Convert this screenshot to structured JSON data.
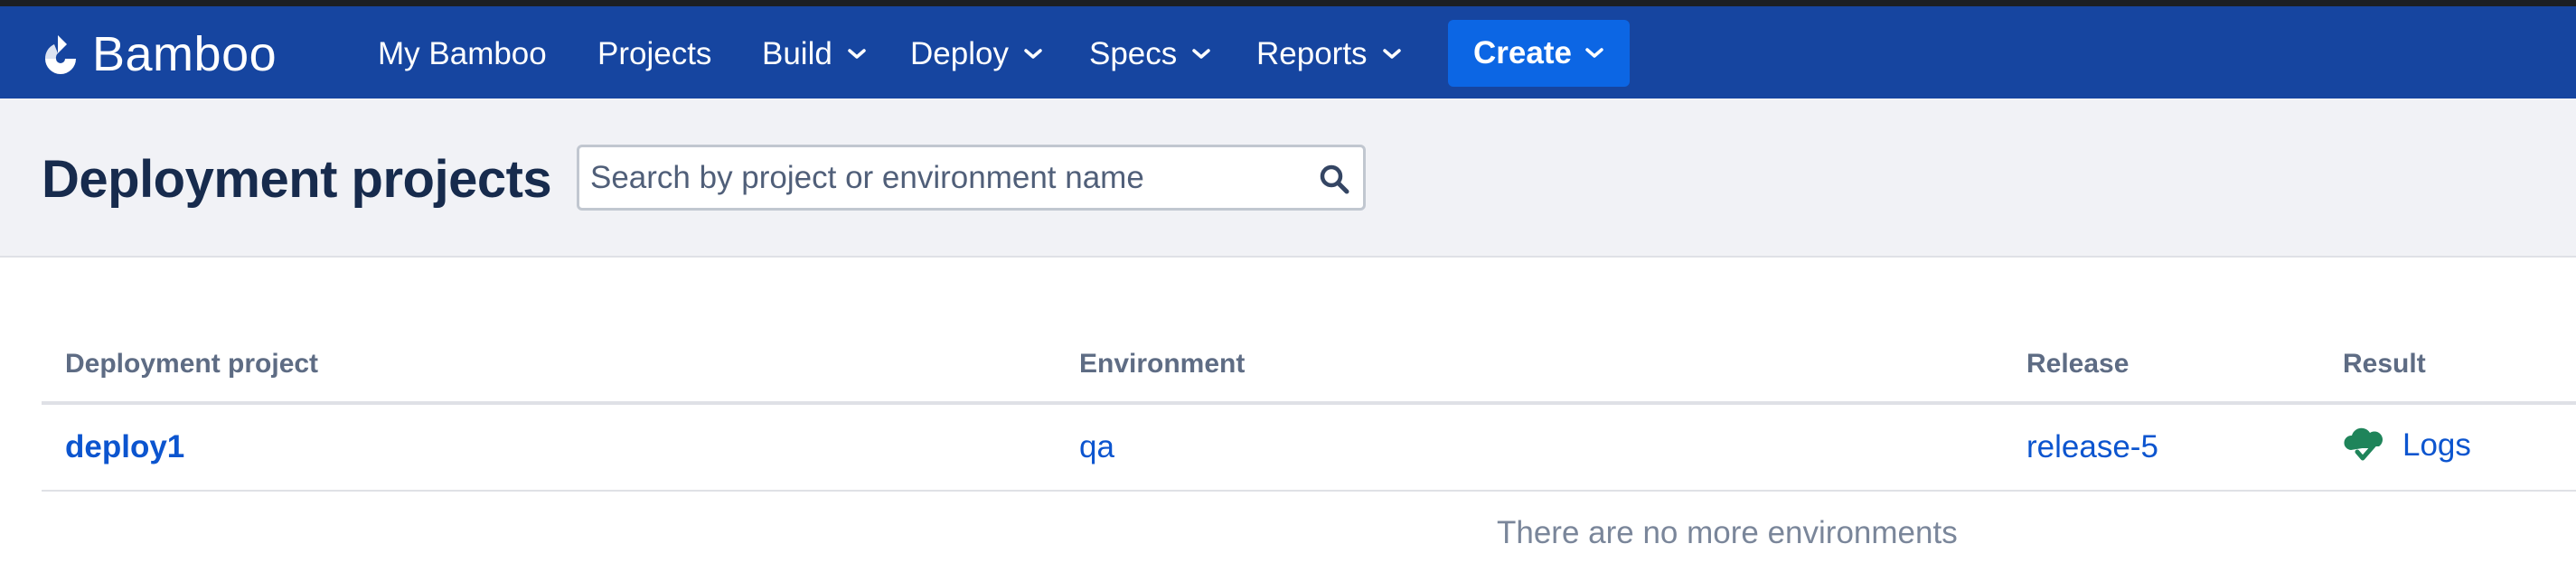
{
  "app": {
    "name": "Bamboo"
  },
  "nav": {
    "items": [
      {
        "label": "My Bamboo",
        "has_dropdown": false
      },
      {
        "label": "Projects",
        "has_dropdown": false
      },
      {
        "label": "Build",
        "has_dropdown": true
      },
      {
        "label": "Deploy",
        "has_dropdown": true
      },
      {
        "label": "Specs",
        "has_dropdown": true
      },
      {
        "label": "Reports",
        "has_dropdown": true
      }
    ],
    "create_label": "Create"
  },
  "page": {
    "title": "Deployment projects"
  },
  "search": {
    "placeholder": "Search by project or environment name",
    "value": ""
  },
  "table": {
    "columns": [
      "Deployment project",
      "Environment",
      "Release",
      "Result"
    ],
    "rows": [
      {
        "project": "deploy1",
        "environment": "qa",
        "release": "release-5",
        "result_link": "Logs",
        "result_icon": "deploy-success-icon"
      }
    ],
    "empty_message": "There are no more environments"
  },
  "colors": {
    "navbar": "#1645a0",
    "create_button": "#0c66e4",
    "link": "#0c55cf",
    "success": "#1f845a",
    "header_band": "#f1f2f6"
  }
}
